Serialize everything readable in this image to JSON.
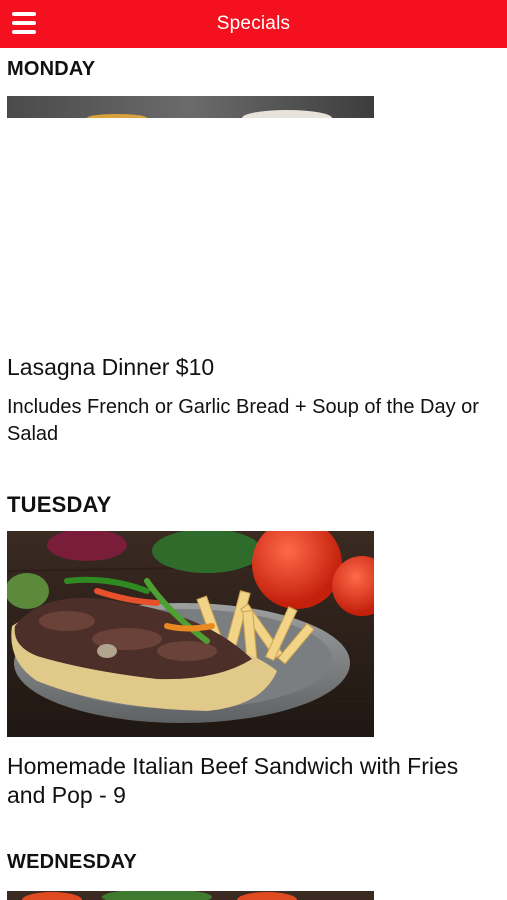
{
  "header": {
    "title": "Specials",
    "menu_icon": "hamburger-menu-icon",
    "background": "#f5101f"
  },
  "days": [
    {
      "day": "MONDAY",
      "item_title": "Lasagna Dinner $10",
      "item_description": "Includes French or Garlic Bread + Soup of the Day or Salad"
    },
    {
      "day": "TUESDAY",
      "item_title": "Homemade Italian Beef Sandwich with Fries and Pop - 9"
    },
    {
      "day": "WEDNESDAY"
    }
  ]
}
